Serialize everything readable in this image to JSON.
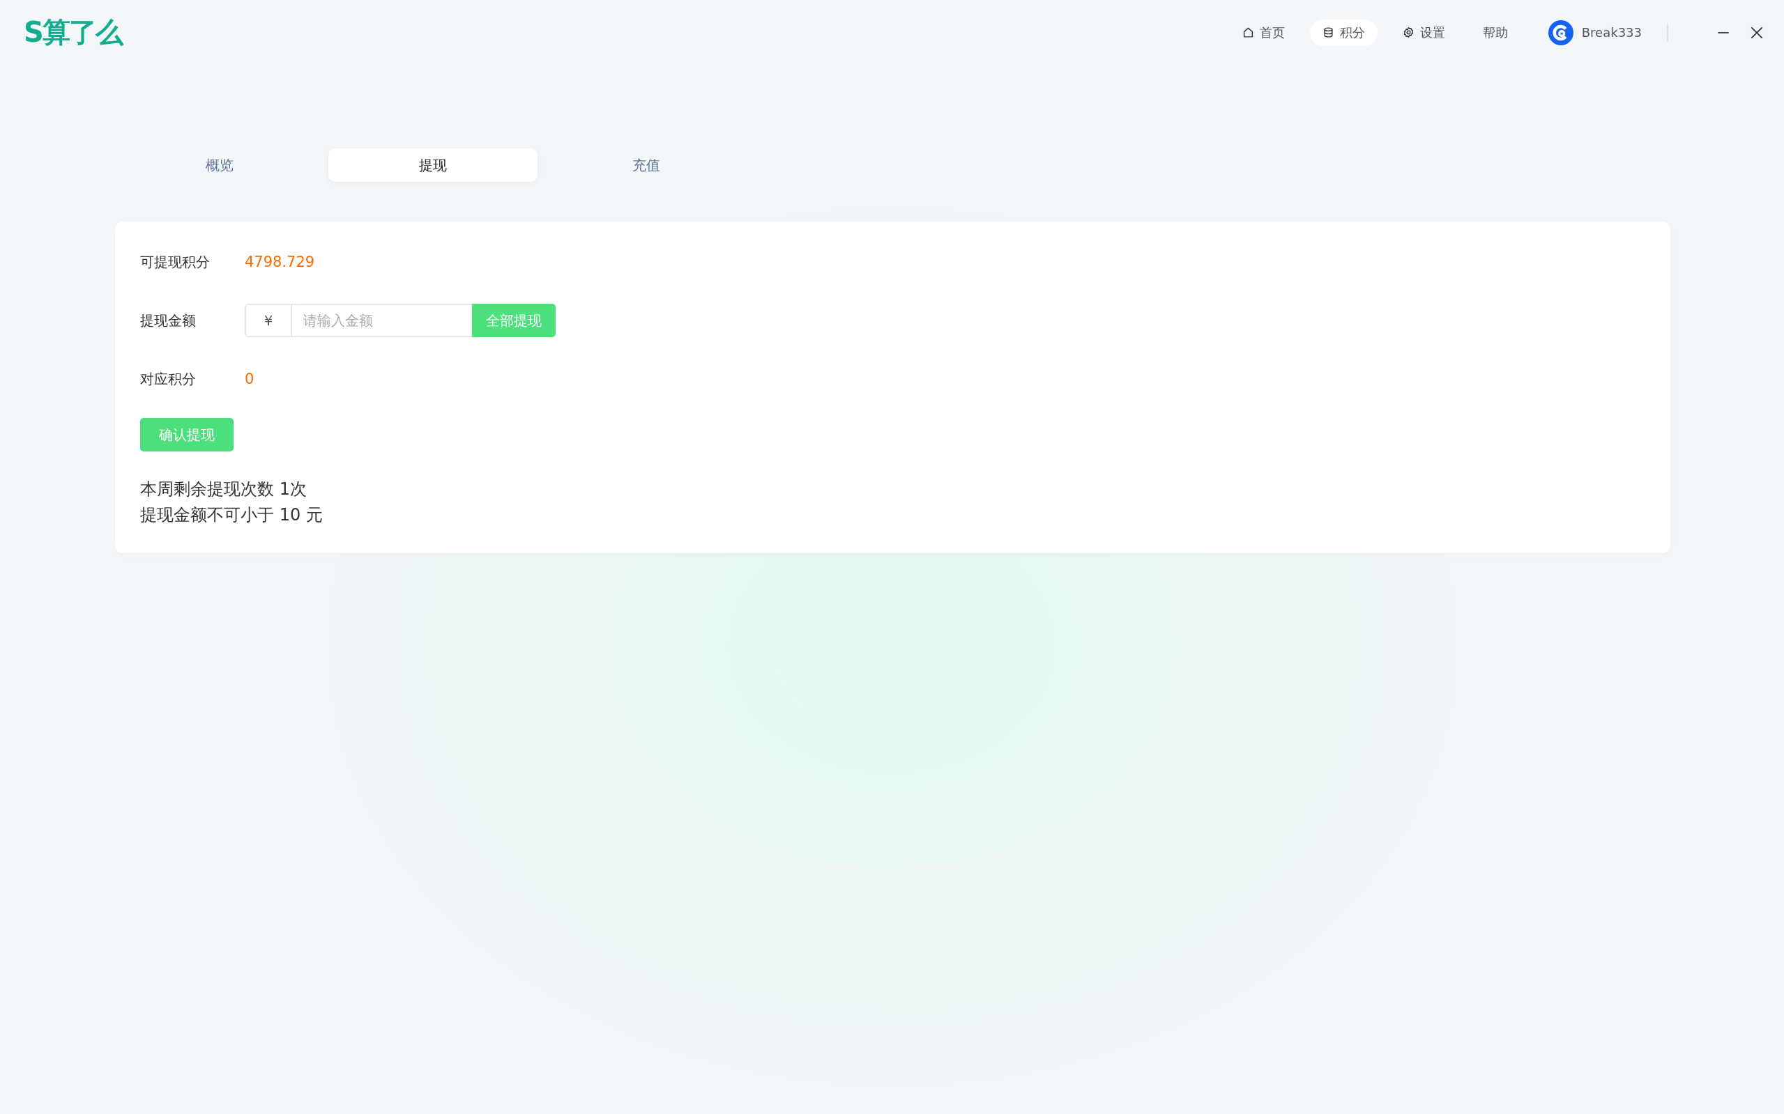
{
  "app": {
    "logo": "S算了么"
  },
  "nav": [
    {
      "kind": "home",
      "label": "首页",
      "selected": false
    },
    {
      "kind": "points",
      "label": "积分",
      "selected": true
    },
    {
      "kind": "settings",
      "label": "设置",
      "selected": false
    },
    {
      "kind": "help",
      "label": "帮助",
      "selected": false
    }
  ],
  "user": {
    "name": "Break333"
  },
  "tabs": [
    {
      "label": "概览",
      "selected": false
    },
    {
      "label": "提现",
      "selected": true
    },
    {
      "label": "充值",
      "selected": false
    }
  ],
  "form": {
    "available": {
      "label": "可提现积分",
      "value": "4798.729"
    },
    "amount": {
      "label": "提现金额",
      "currency": "¥",
      "placeholder": "请输入金额",
      "all_button": "全部提现"
    },
    "points": {
      "label": "对应积分",
      "value": "0"
    },
    "confirm_button": "确认提现",
    "notes": [
      "本周剩余提现次数 1次",
      "提现金额不可小于 10 元"
    ]
  }
}
